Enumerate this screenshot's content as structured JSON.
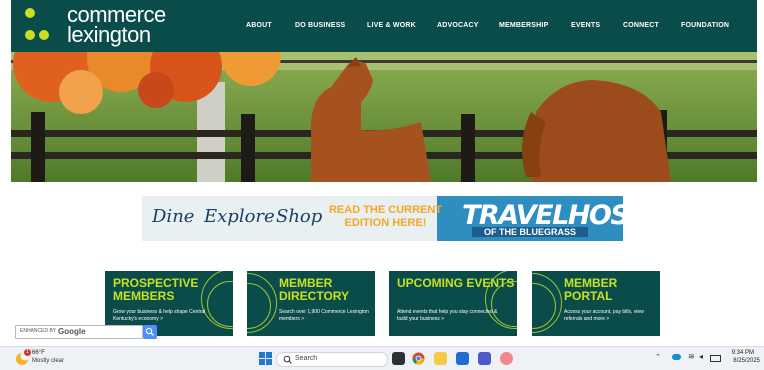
{
  "brand": {
    "line1": "commerce",
    "line2": "lexington",
    "accent": "#c8e020",
    "header_bg": "#0a4c4a"
  },
  "nav": [
    {
      "label": "ABOUT"
    },
    {
      "label": "DO BUSINESS"
    },
    {
      "label": "LIVE & WORK"
    },
    {
      "label": "ADVOCACY"
    },
    {
      "label": "MEMBERSHIP"
    },
    {
      "label": "EVENTS"
    },
    {
      "label": "CONNECT"
    },
    {
      "label": "FOUNDATION"
    }
  ],
  "banner": {
    "dine": "Dine",
    "explore": "Explore",
    "shop": "Shop",
    "cta": "READ THE CURRENT EDITION HERE!",
    "brand": "TRAVELHOST",
    "subtitle": "OF THE BLUEGRASS"
  },
  "cards": [
    {
      "title": "PROSPECTIVE MEMBERS",
      "desc": "Grow your business & help shape Central Kentucky's economy >"
    },
    {
      "title": "MEMBER DIRECTORY",
      "desc": "Search over 1,900 Commerce Lexington members >"
    },
    {
      "title": "UPCOMING EVENTS",
      "desc": "Attend events that help you stay connected & build your business >"
    },
    {
      "title": "MEMBER PORTAL",
      "desc": "Access your account, pay bills, view referrals and more >"
    }
  ],
  "google_search": {
    "label": "ENHANCED BY",
    "brand": "Google"
  },
  "taskbar": {
    "weather_temp": "66°F",
    "weather_condition": "Mostly clear",
    "weather_badge": "1",
    "search_placeholder": "Search",
    "time": "9:34 PM",
    "date": "8/25/2025"
  }
}
